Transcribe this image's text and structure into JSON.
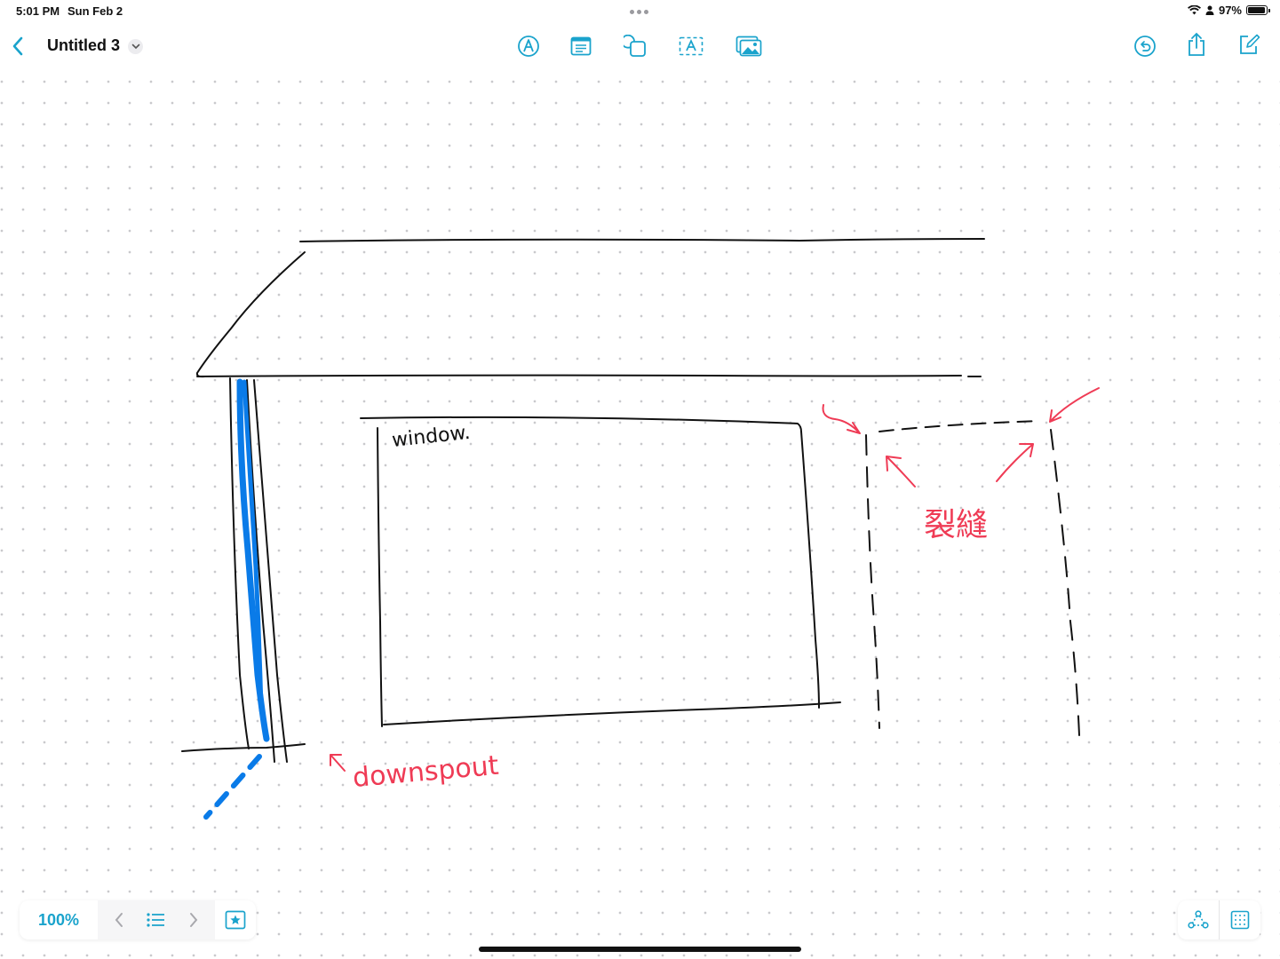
{
  "status_bar": {
    "time": "5:01 PM",
    "date": "Sun Feb 2",
    "battery_percent": "97%",
    "battery_level": 0.97
  },
  "toolbar": {
    "title": "Untitled 3",
    "accent_color": "#1aa3cc",
    "icons": [
      "back-icon",
      "pen-icon",
      "note-icon",
      "shapes-icon",
      "text-box-icon",
      "image-icon",
      "undo-icon",
      "share-icon",
      "compose-icon"
    ]
  },
  "canvas": {
    "ink_colors": {
      "black": "#111111",
      "blue": "#0a7be8",
      "red": "#ef3b55"
    },
    "labels": {
      "window": "window.",
      "downspout": "downspout",
      "crack": "裂縫"
    }
  },
  "bottom_bar": {
    "zoom": "100%",
    "icons": [
      "previous-icon",
      "list-icon",
      "next-icon",
      "favorite-icon",
      "connectors-icon",
      "grid-icon"
    ]
  }
}
